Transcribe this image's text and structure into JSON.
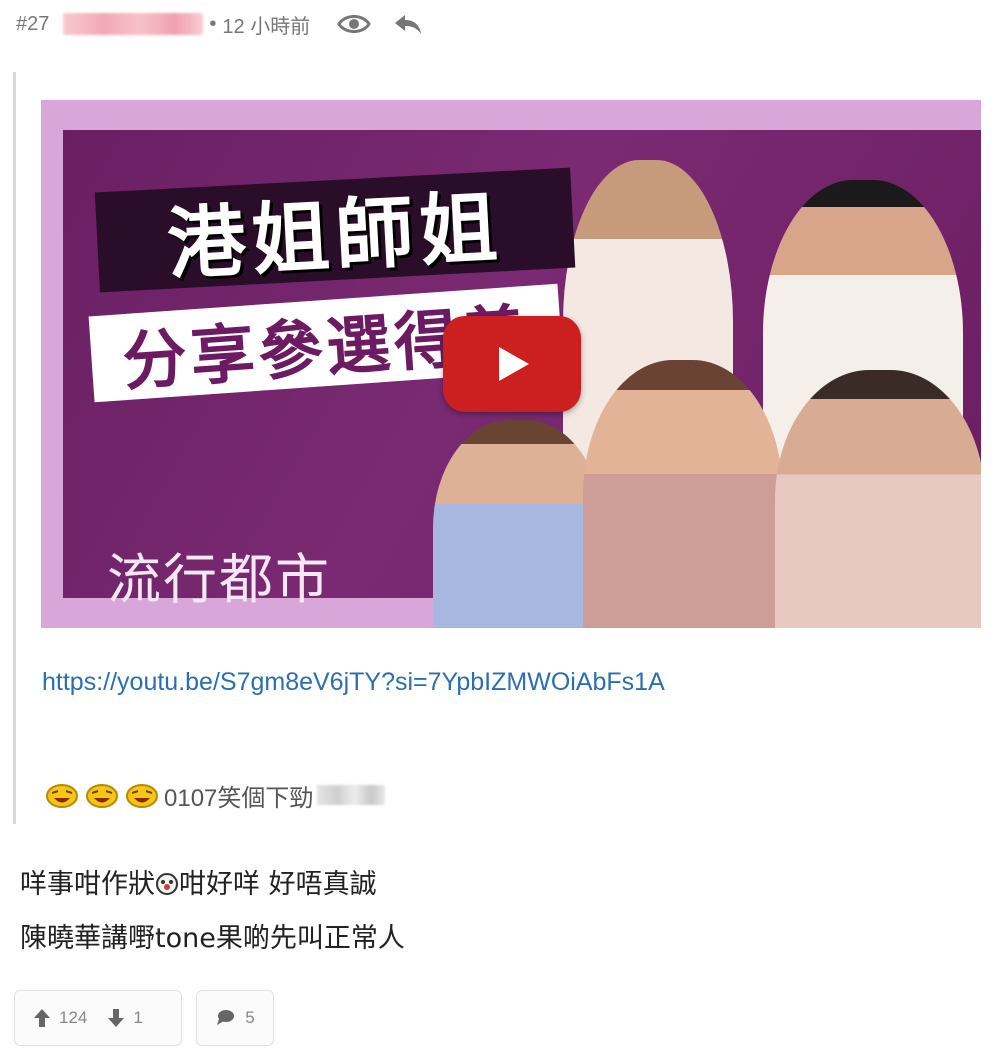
{
  "header": {
    "post_number": "#27",
    "separator": "•",
    "time": "12 小時前"
  },
  "video": {
    "title_line1": "港姐師姐",
    "title_line2": "分享參選得着",
    "brand": "流行都市",
    "link": "https://youtu.be/S7gm8eV6jTY?si=7YpbIZMWOiAbFs1A"
  },
  "quote": {
    "text": "0107笑個下勁"
  },
  "body": {
    "line1_part1": "咩事咁作狀",
    "line1_part2": "咁好咩 好唔真誠",
    "line2": "陳曉華講嘢tone果啲先叫正常人"
  },
  "actions": {
    "upvotes": "124",
    "downvotes": "1",
    "comments": "5"
  },
  "colors": {
    "link": "#2a6fb0",
    "play_button": "#cc1f1f",
    "thumbnail_bg": "#7a2a72",
    "meta_text": "#777777"
  }
}
